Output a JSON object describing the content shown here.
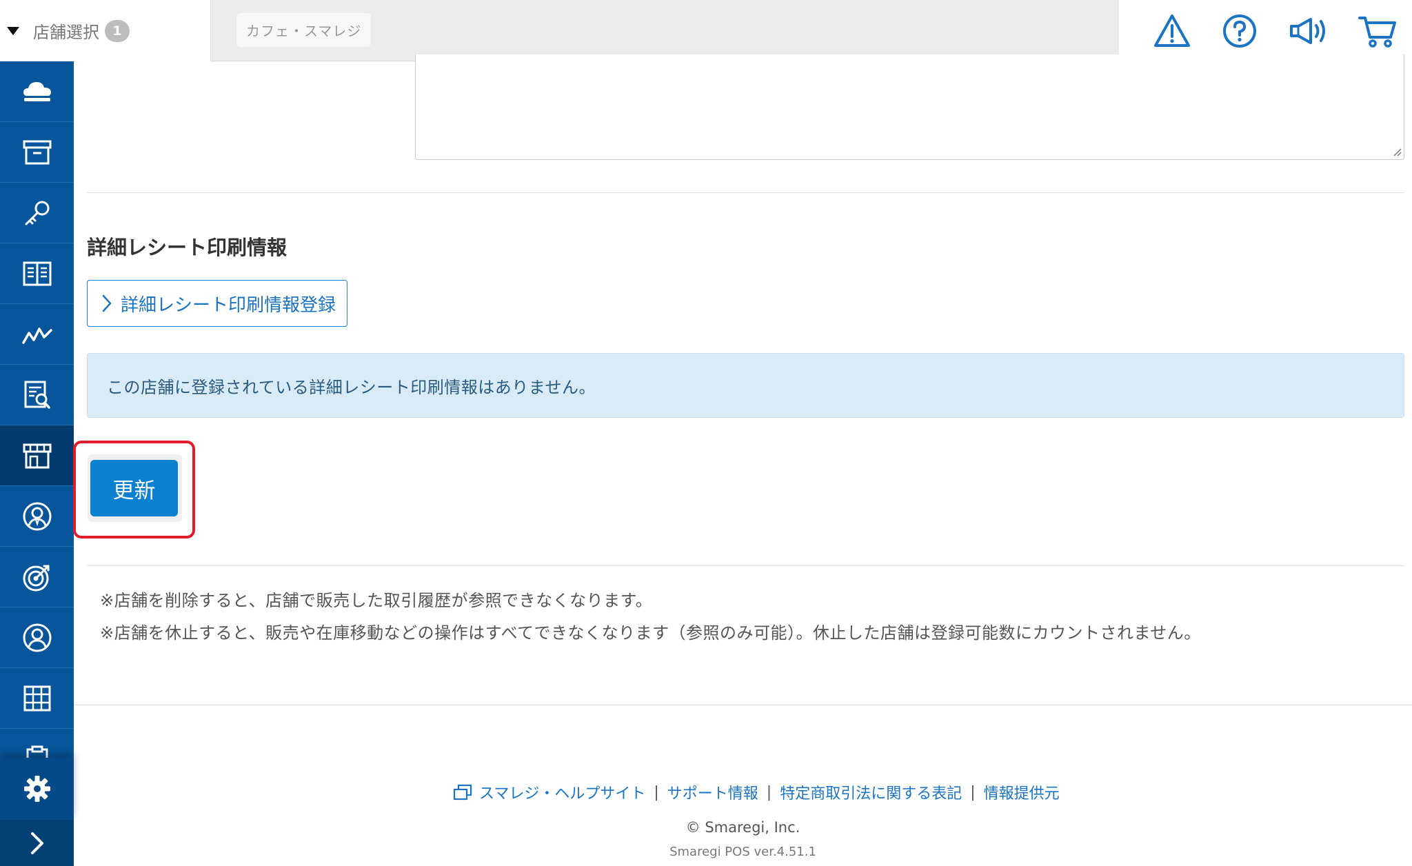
{
  "header": {
    "store_select_label": "店舗選択",
    "store_count": "1",
    "store_chip": "カフェ・スマレジ",
    "icons": [
      "warning-icon",
      "help-icon",
      "megaphone-icon",
      "cart-icon"
    ]
  },
  "sidebar": {
    "items": [
      "cloud-icon",
      "archive-box-icon",
      "key-icon",
      "book-icon",
      "chart-line-icon",
      "report-search-icon",
      "store-icon",
      "staff-user-icon",
      "target-icon",
      "customer-icon",
      "grid-icon",
      "clipboard-icon"
    ],
    "active_item": "store-icon",
    "settings_icon": "gear-icon",
    "expand_icon": "chevron-right-icon"
  },
  "main": {
    "section_title": "詳細レシート印刷情報",
    "register_button_label": "詳細レシート印刷情報登録",
    "info_message": "この店舗に登録されている詳細レシート印刷情報はありません。",
    "update_button_label": "更新",
    "notes": [
      "※店舗を削除すると、店舗で販売した取引履歴が参照できなくなります。",
      "※店舗を休止すると、販売や在庫移動などの操作はすべてできなくなります（参照のみ可能）。休止した店舗は登録可能数にカウントされません。"
    ]
  },
  "footer": {
    "links": [
      "スマレジ・ヘルプサイト",
      "サポート情報",
      "特定商取引法に関する表記",
      "情報提供元"
    ],
    "separator": "|",
    "copyright": "© Smaregi, Inc.",
    "version": "Smaregi POS ver.4.51.1"
  },
  "colors": {
    "sidebar": "#07559b",
    "sidebar_active": "#043b6f",
    "primary": "#0b7fd0",
    "link": "#1b74c3",
    "info_bg": "#d9ebf6",
    "highlight": "#e01d2a"
  }
}
